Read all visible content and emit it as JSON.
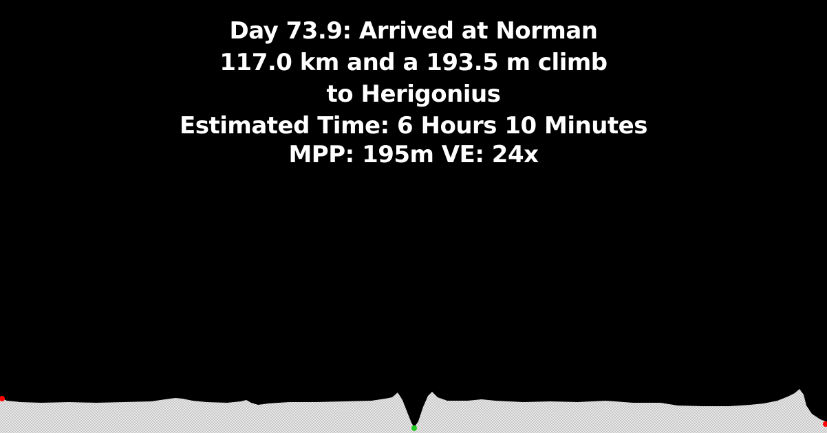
{
  "header": {
    "line1": "Day 73.9: Arrived at Norman",
    "line2": "117.0 km and a 193.5 m climb",
    "line3": "to Herigonius",
    "line4": "Estimated Time: 6 Hours 10 Minutes",
    "line5": "MPP: 195m VE: 24x"
  },
  "colors": {
    "background": "#000000",
    "text": "#ffffff",
    "terrain_fill": "#d8d8d8",
    "start_marker": "#ff0000",
    "mid_marker": "#22cc22",
    "end_marker": "#ff0000"
  }
}
